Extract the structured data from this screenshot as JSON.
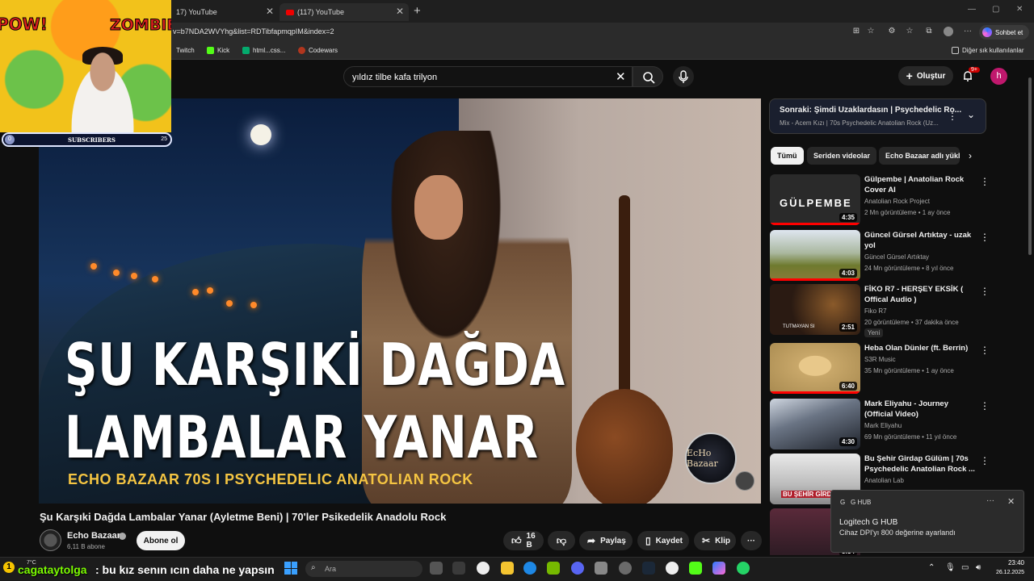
{
  "browser": {
    "tabs": [
      {
        "label": "17) YouTube"
      },
      {
        "label": "(117) YouTube"
      }
    ],
    "url": "v=b7NDA2WVYhg&list=RDTibfapmqpIM&index=2",
    "copilot_label": "Sohbet et",
    "bookmarks": [
      {
        "label": "Twitch",
        "icon": "twitch-icon",
        "color": "#9146ff"
      },
      {
        "label": "Kick",
        "icon": "kick-icon",
        "color": "#53fc18"
      },
      {
        "label": "html...css...",
        "icon": "w3-icon",
        "color": "#04aa6d"
      },
      {
        "label": "Codewars",
        "icon": "codewars-icon",
        "color": "#b1361e"
      }
    ],
    "other_bookmarks": "Diğer sık kullanılanlar"
  },
  "youtube": {
    "search_value": "yıldız tilbe kafa trilyon",
    "create_label": "Oluştur",
    "notifications_badge": "9+",
    "avatar_letter": "h"
  },
  "video": {
    "thumbnail_line1": "ŞU KARŞIKİ DAĞDA",
    "thumbnail_line2": "LAMBALAR YANAR",
    "thumbnail_subtitle": "ECHO BAZAAR 70S I PSYCHEDELIC ANATOLIAN ROCK",
    "logo_text": "EcHo Bazaar",
    "title": "Şu Karşıki Dağda Lambalar Yanar (Ayletme Beni) | 70'ler Psikedelik Anadolu Rock",
    "channel": "Echo Bazaar",
    "subscribers": "6,11 B abone",
    "subscribe_label": "Abone ol",
    "likes": "16 B",
    "share_label": "Paylaş",
    "save_label": "Kaydet",
    "clip_label": "Klip",
    "more_label": "···"
  },
  "webcam": {
    "pow_text": "POW!",
    "zombie_text": "ZOMBIE!",
    "subscribers_label": "SUBSCRIBERS",
    "subscribers_start": "0",
    "subscribers_goal": "25"
  },
  "sidebar": {
    "up_next_title": "Sonraki: Şimdi Uzaklardasın | Psychedelic Ro...",
    "up_next_sub": "Mix - Acem Kızı | 70s Psychedelic Anatolian Rock (Uz...",
    "chips": [
      "Tümü",
      "Seriden videolar",
      "Echo Bazaar adlı yükl"
    ],
    "items": [
      {
        "title": "Gülpembe | Anatolian Rock Cover AI",
        "channel": "Anatolian Rock Project",
        "meta": "2 Mn görüntüleme • 1 ay önce",
        "duration": "4:35",
        "thumb_text": "GÜLPEMBE",
        "thumb_color": "#2a2a2a"
      },
      {
        "title": "Güncel Gürsel Artıktay - uzak yol",
        "channel": "Güncel Gürsel Artıktay",
        "meta": "24 Mn görüntüleme • 8 yıl önce",
        "duration": "4:03",
        "thumb_text": "",
        "thumb_color": "#8a8a4a"
      },
      {
        "title": "FİKO R7 - HERŞEY EKSİK ( Offical Audio )",
        "channel": "Fiko   R7",
        "meta": "20 görüntüleme • 37 dakika önce",
        "duration": "2:51",
        "thumb_text": "TUTMAYAN SI",
        "thumb_color": "#3a2a1e",
        "badge": "Yeni"
      },
      {
        "title": "Heba Olan Dünler (ft. Berrin)",
        "channel": "S3R Music",
        "meta": "35 Mn görüntüleme • 1 ay önce",
        "duration": "6:40",
        "thumb_text": "",
        "thumb_color": "#c9a86a"
      },
      {
        "title": "Mark Eliyahu - Journey (Official Video)",
        "channel": "Mark Eliyahu",
        "meta": "69 Mn görüntüleme • 11 yıl önce",
        "duration": "4:30",
        "thumb_text": "",
        "thumb_color": "#3a3f4a"
      },
      {
        "title": "Bu Şehir Girdap Gülüm | 70s Psychedelic Anatolian Rock ...",
        "channel": "Anatolian Lab",
        "meta": "",
        "duration": "",
        "thumb_text": "BU ŞEHİR GİRDAP",
        "thumb_color": "#d8d8d8"
      },
      {
        "title": "",
        "channel": "",
        "meta": "",
        "duration": "5:34",
        "thumb_text": "",
        "thumb_color": "#5a2a3a"
      }
    ]
  },
  "notification": {
    "app": "G HUB",
    "title": "Logitech G HUB",
    "body": "Cihaz DPI'yı 800 değerine ayarlandı"
  },
  "taskbar": {
    "weather_badge": "1",
    "temperature": "7°C",
    "chat_user": "cagataytolga",
    "chat_message": ": bu kız senın ıcın daha ne yapsın",
    "search_placeholder": "Ara",
    "time": "23:40",
    "date": "26.12.2025"
  }
}
